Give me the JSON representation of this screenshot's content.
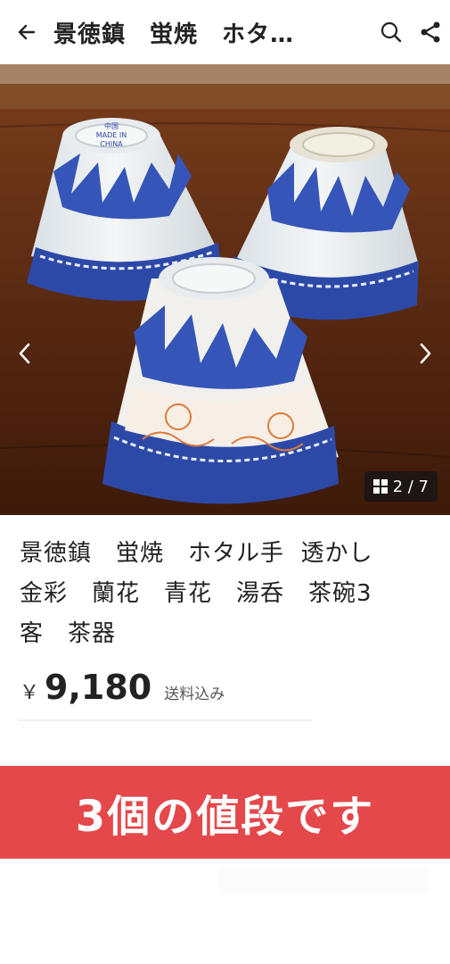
{
  "header": {
    "title": "景徳鎮　蛍焼　ホタ…",
    "back_icon": "arrow-left-icon",
    "search_icon": "search-icon",
    "share_icon": "share-icon"
  },
  "gallery": {
    "counter": "2 / 7",
    "prev_icon": "chevron-left-icon",
    "next_icon": "chevron-right-icon",
    "cup_marks": [
      "中国",
      "MADE IN",
      "CHINA"
    ]
  },
  "product": {
    "title": "景徳鎮　蛍焼　ホタル手  透かし\n金彩　蘭花　青花　湯呑　茶碗3\n客　茶器",
    "currency": "￥",
    "price": "9,180",
    "shipping": "送料込み"
  },
  "banner": {
    "text": "3個の値段です",
    "color": "#e4484b"
  }
}
